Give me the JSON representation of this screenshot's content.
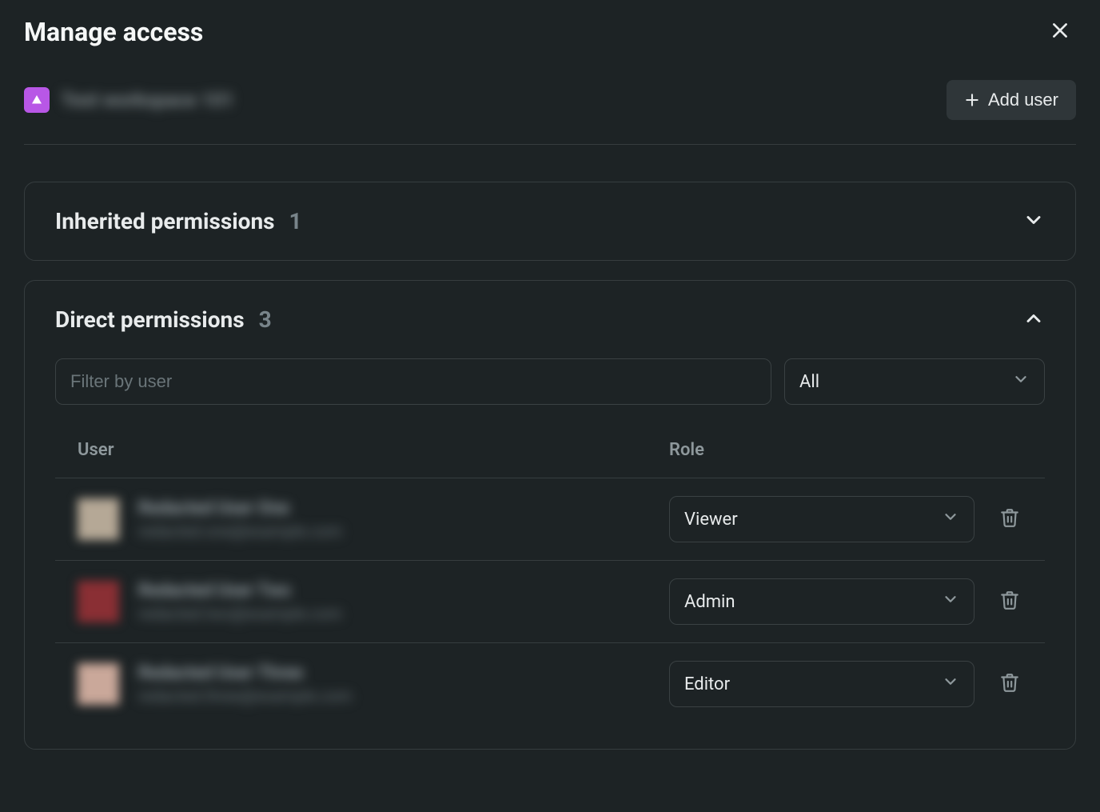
{
  "header": {
    "title": "Manage access"
  },
  "workspace": {
    "name": "Test workspace 101",
    "icon_color": "#b857e6",
    "add_user_label": "Add user"
  },
  "sections": {
    "inherited": {
      "title": "Inherited permissions",
      "count": "1",
      "expanded": false
    },
    "direct": {
      "title": "Direct permissions",
      "count": "3",
      "expanded": true,
      "filter_placeholder": "Filter by user",
      "role_filter_value": "All",
      "columns": {
        "user": "User",
        "role": "Role"
      },
      "rows": [
        {
          "name": "Redacted User One",
          "email": "redacted.one@example.com",
          "role": "Viewer"
        },
        {
          "name": "Redacted User Two",
          "email": "redacted.two@example.com",
          "role": "Admin"
        },
        {
          "name": "Redacted User Three",
          "email": "redacted.three@example.com",
          "role": "Editor"
        }
      ]
    }
  }
}
